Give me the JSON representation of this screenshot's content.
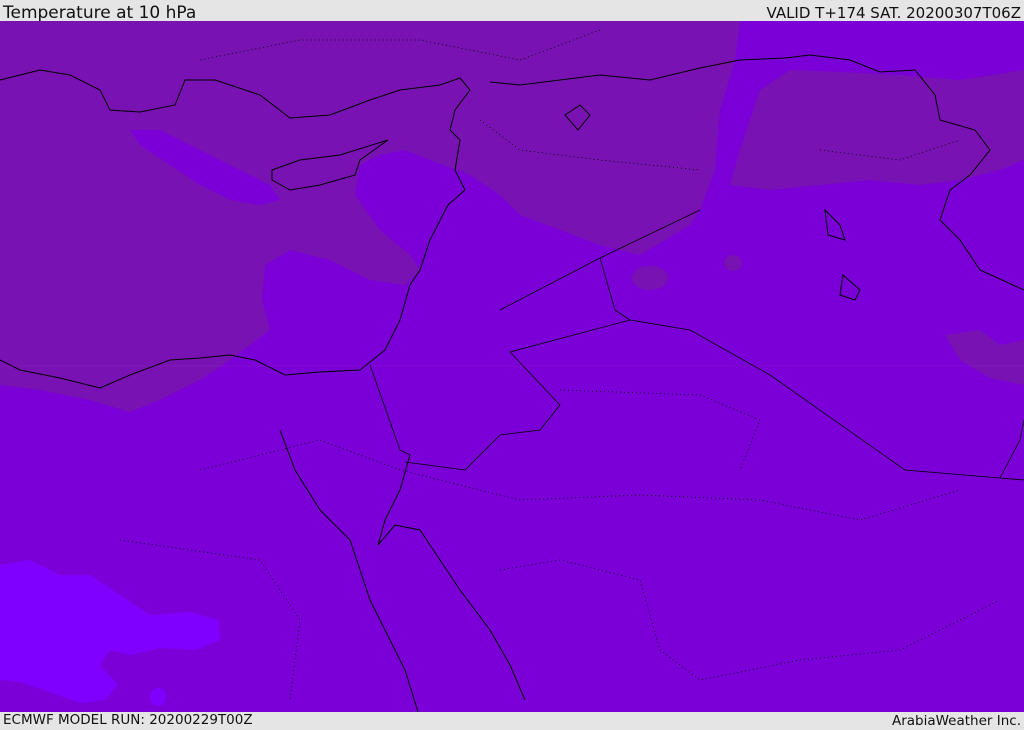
{
  "header": {
    "title": "Temperature at 10 hPa",
    "valid": "VALID T+174 SAT. 20200307T06Z"
  },
  "footer": {
    "model_run": "ECMWF MODEL RUN: 20200229T00Z",
    "credit": "ArabiaWeather Inc."
  },
  "map": {
    "colors": {
      "base": "#7b00d8",
      "cold_region": "#7912b2",
      "warm_region": "#7f00ff",
      "coastline": "#000000"
    }
  }
}
